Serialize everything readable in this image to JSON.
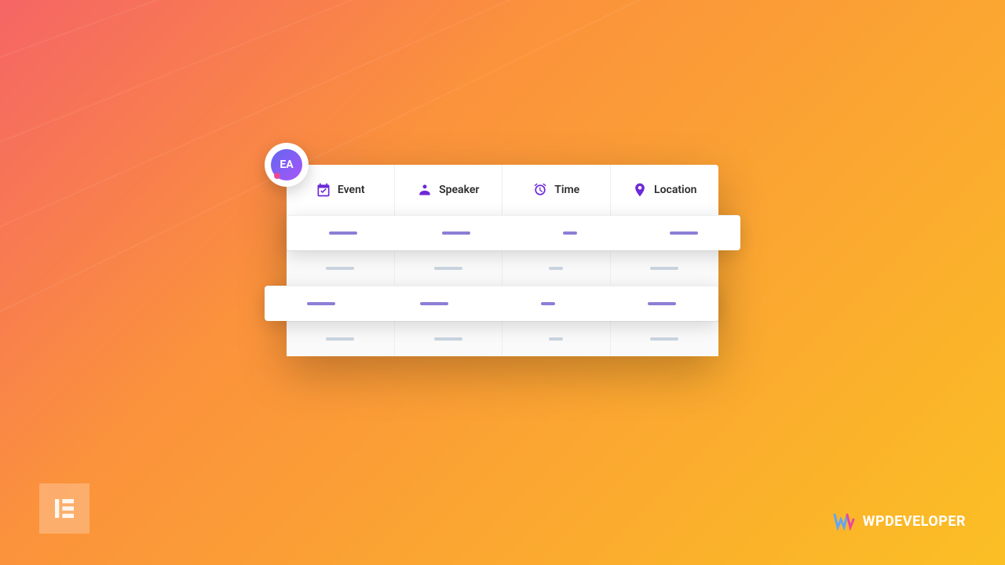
{
  "badge": {
    "label": "EA"
  },
  "table": {
    "headers": [
      {
        "icon": "event-icon",
        "label": "Event"
      },
      {
        "icon": "speaker-icon",
        "label": "Speaker"
      },
      {
        "icon": "clock-icon",
        "label": "Time"
      },
      {
        "icon": "location-icon",
        "label": "Location"
      }
    ]
  },
  "brand": {
    "wpdeveloper": "WPDEVELOPER"
  }
}
